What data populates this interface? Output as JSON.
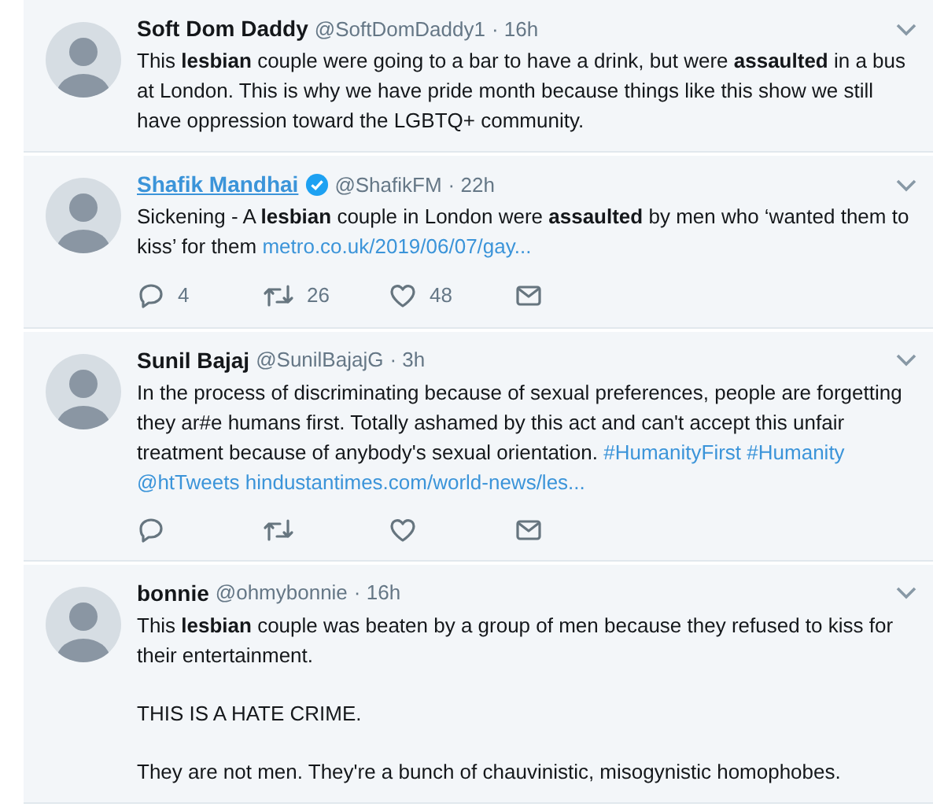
{
  "tweets": [
    {
      "name": "Soft Dom Daddy",
      "name_link": false,
      "verified": false,
      "handle": "@SoftDomDaddy1",
      "time": "· 16h",
      "paragraphs": [
        [
          {
            "kind": "text",
            "text": "This **lesbian** couple were going to a bar to have a drink, but were **assaulted** in a bus at London. This is why we have pride month because things like this show we still have oppression toward the LGBTQ+ community."
          }
        ]
      ]
    },
    {
      "name": "Shafik Mandhai",
      "name_link": true,
      "verified": true,
      "handle": "@ShafikFM",
      "time": "· 22h",
      "paragraphs": [
        [
          {
            "kind": "text",
            "text": "Sickening - A **lesbian** couple in London were **assaulted** by men who ‘wanted them to kiss’ for them"
          },
          {
            "kind": "link",
            "text": "metro.co.uk/2019/06/07/gay..."
          }
        ]
      ],
      "actions": [
        {
          "kind": "reply",
          "count": "4"
        },
        {
          "kind": "retweet",
          "count": "26"
        },
        {
          "kind": "like",
          "count": "48"
        },
        {
          "kind": "message"
        }
      ]
    },
    {
      "name": "Sunil Bajaj",
      "name_link": false,
      "verified": false,
      "handle": "@SunilBajajG",
      "time": "· 3h",
      "paragraphs": [
        [
          {
            "kind": "text",
            "text": "In the process of discriminating because of sexual preferences, people are forgetting they ar#e humans first. Totally ashamed by this act and can't accept this unfair treatment because of anybody's sexual orientation."
          },
          {
            "kind": "link",
            "text": "#HumanityFirst"
          },
          {
            "kind": "link",
            "text": "#Humanity"
          },
          {
            "kind": "link",
            "text": "@htTweets"
          },
          {
            "kind": "link",
            "text": "hindustantimes.com/world-news/les..."
          }
        ]
      ],
      "actions": [
        {
          "kind": "reply"
        },
        {
          "kind": "retweet"
        },
        {
          "kind": "like"
        },
        {
          "kind": "message"
        }
      ]
    },
    {
      "name": "bonnie",
      "name_link": false,
      "verified": false,
      "handle": "@ohmybonnie",
      "time": "· 16h",
      "paragraphs": [
        [
          {
            "kind": "text",
            "text": "This **lesbian** couple was beaten by a group of men because they refused to kiss for their entertainment."
          }
        ],
        [
          {
            "kind": "text",
            "text": "THIS IS A HATE CRIME."
          }
        ],
        [
          {
            "kind": "text",
            "text": "They are not men. They're a bunch of chauvinistic, misogynistic homophobes."
          }
        ]
      ]
    }
  ]
}
